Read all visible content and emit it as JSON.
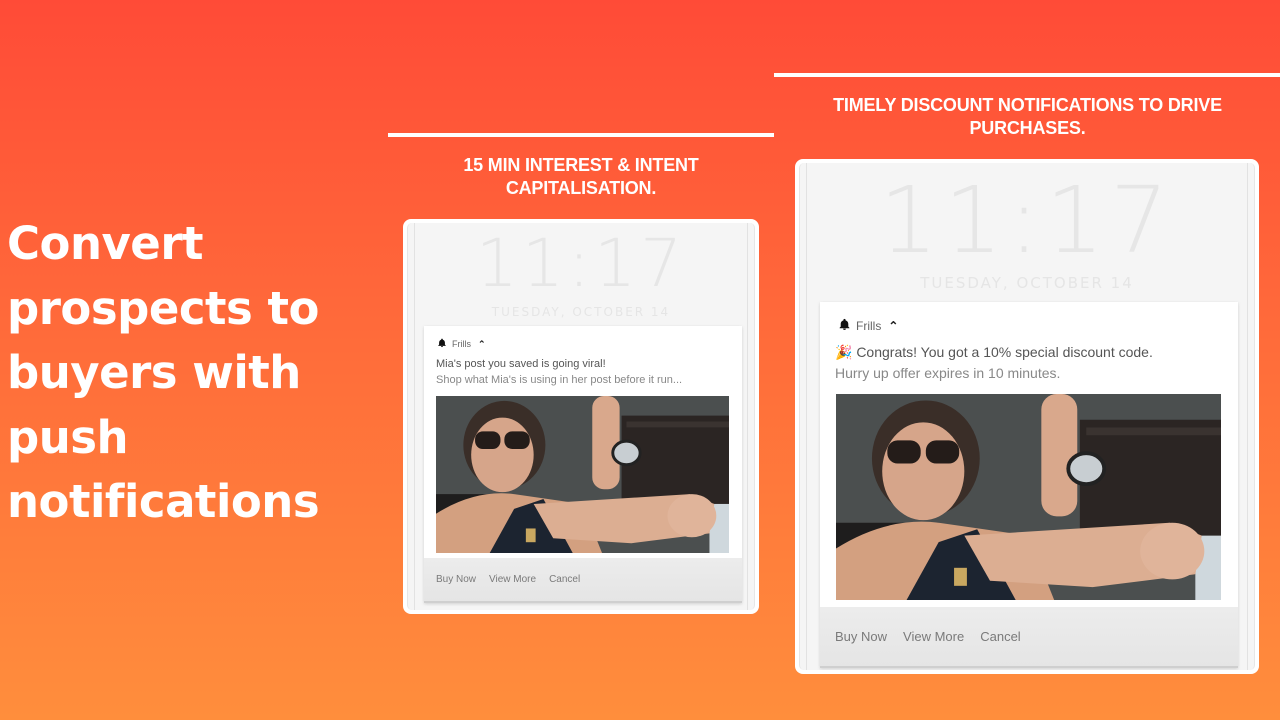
{
  "headline": "Convert prospects to buyers with push notifications",
  "panels": [
    {
      "caption": "15 MIN INTEREST & INTENT CAPITALISATION.",
      "lockscreen": {
        "time": "11:17",
        "date": "TUESDAY, OCTOBER 14"
      },
      "notification": {
        "icon": "bell-icon",
        "app_name": "Frills",
        "expand_icon": "chevron-up-icon",
        "title": "Mia's post you saved is going viral!",
        "body": "Shop what Mia's is using in her post before it run...",
        "image": "two women in sunglasses posing",
        "actions": [
          "Buy Now",
          "View More",
          "Cancel"
        ]
      }
    },
    {
      "caption": "TIMELY DISCOUNT NOTIFICATIONS TO DRIVE PURCHASES.",
      "lockscreen": {
        "time": "11:17",
        "date": "TUESDAY, OCTOBER 14"
      },
      "notification": {
        "icon": "bell-icon",
        "app_name": "Frills",
        "expand_icon": "chevron-up-icon",
        "title": "🎉 Congrats! You got a 10% special discount code.",
        "body": "Hurry up offer expires in 10 minutes.",
        "image": "two women in sunglasses posing",
        "actions": [
          "Buy Now",
          "View More",
          "Cancel"
        ]
      }
    }
  ],
  "colors": {
    "background_top": "#ff4b37",
    "background_bottom": "#ff8e3c",
    "text": "#ffffff"
  }
}
